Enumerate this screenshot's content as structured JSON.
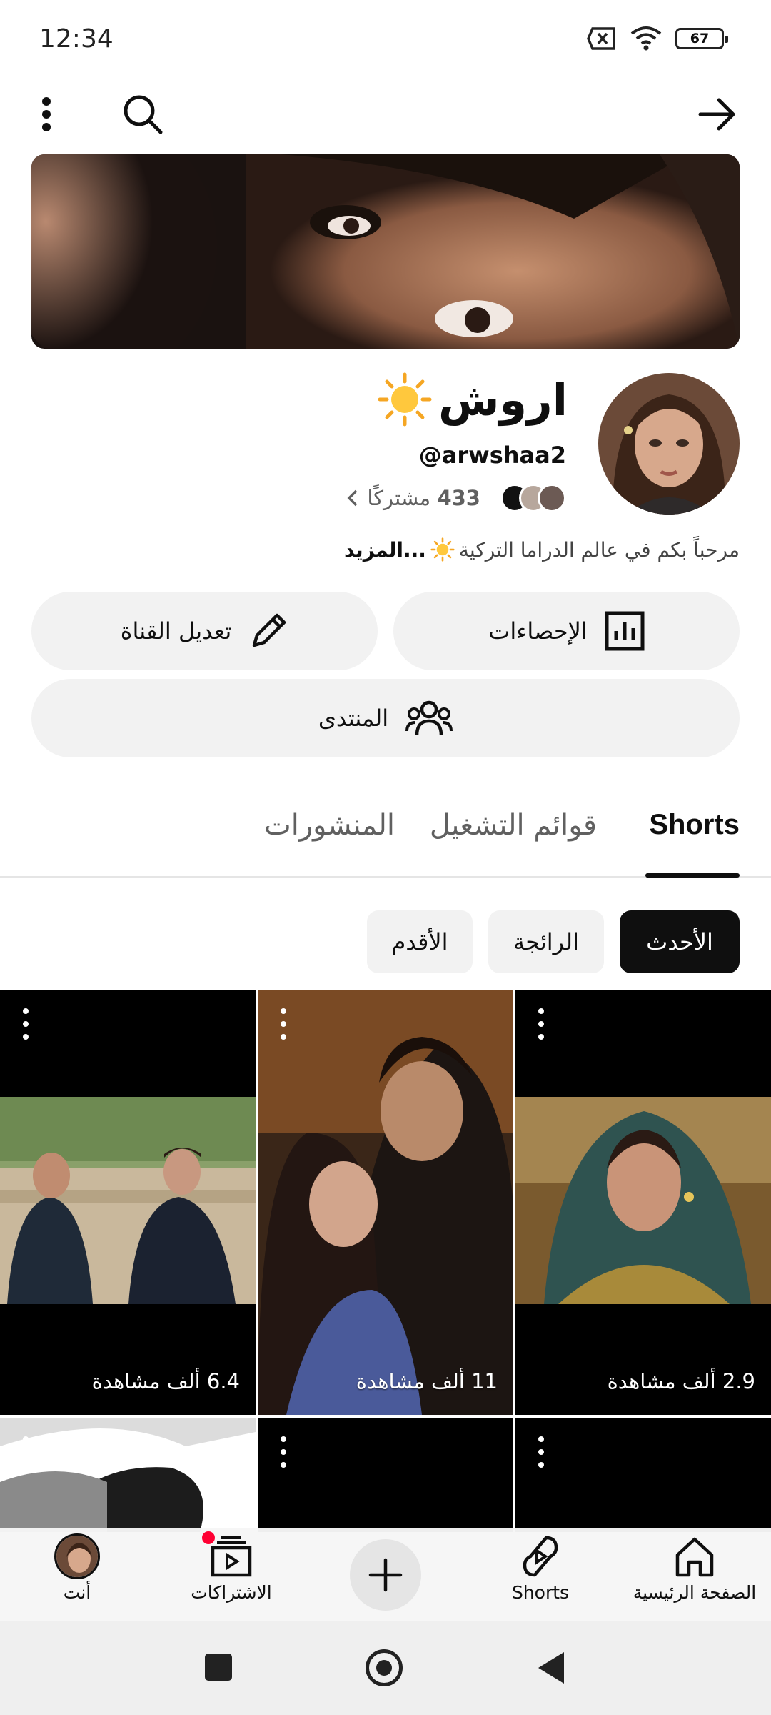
{
  "status_bar": {
    "time": "12:34",
    "battery": "67",
    "icons": [
      "sim-off-icon",
      "wifi-icon",
      "battery-icon"
    ]
  },
  "top_bar": {
    "icons": [
      "more-vert-icon",
      "search-icon",
      "arrow-forward-icon"
    ]
  },
  "channel": {
    "name": "اروش",
    "handle": "@arwshaa2",
    "subscribers_count": "433",
    "subscribers_label": "مشتركًا",
    "description": "مرحباً بكم في عالم الدراما التركية",
    "more_label": "...المزيد"
  },
  "actions": {
    "edit_channel": "تعديل القناة",
    "analytics": "الإحصاءات",
    "community": "المنتدى"
  },
  "tabs": [
    {
      "label": "Shorts",
      "active": true
    },
    {
      "label": "قوائم التشغيل",
      "active": false
    },
    {
      "label": "المنشورات",
      "active": false
    }
  ],
  "filters": [
    {
      "label": "الأحدث",
      "active": true
    },
    {
      "label": "الرائجة",
      "active": false
    },
    {
      "label": "الأقدم",
      "active": false
    }
  ],
  "shorts": [
    {
      "views": "2.9 ألف مشاهدة"
    },
    {
      "views": "11 ألف مشاهدة"
    },
    {
      "views": "6.4 ألف مشاهدة"
    }
  ],
  "bottom_nav": [
    {
      "label": "الصفحة الرئيسية",
      "icon": "home-icon"
    },
    {
      "label": "Shorts",
      "icon": "shorts-icon"
    },
    {
      "label": "",
      "icon": "add-icon"
    },
    {
      "label": "الاشتراكات",
      "icon": "subscriptions-icon"
    },
    {
      "label": "أنت",
      "icon": "avatar-icon"
    }
  ],
  "colors": {
    "accent": "#0f0f0f",
    "chip_bg": "#f2f2f2",
    "notification_dot": "#ff0033",
    "secondary_text": "#606060"
  }
}
